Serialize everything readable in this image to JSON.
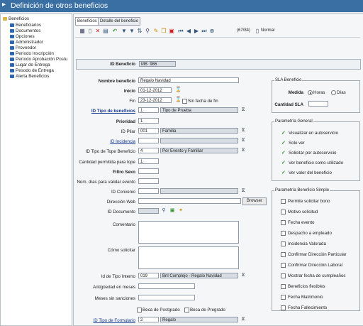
{
  "window": {
    "title": "Definición de otros beneficios"
  },
  "tree": {
    "root": "Beneficios",
    "items": [
      "Beneficiarios",
      "Documentos",
      "Opciones",
      "Administrador",
      "Proveedor",
      "Período Inscripción",
      "Período Aprobación Postu",
      "Lugar de Entrega",
      "Pesodo de Entrega",
      "Alerta Beneficios"
    ]
  },
  "tabs": [
    "Beneficios",
    "Detalle del beneficio"
  ],
  "toolbar": {
    "counter": "(67/84)",
    "mode": "Normal"
  },
  "form": {
    "id_beneficio_label": "ID Beneficio",
    "id_beneficio_value": "MB_986",
    "nombre_label": "Nombre beneficio",
    "nombre_value": "Regalo Navidad",
    "inicio_label": "Inicio",
    "inicio_value": "01-12-2012",
    "fin_label": "Fin",
    "fin_value": "23-12-2012",
    "sin_fecha_label": "Sin fecha de fin",
    "tipo_label": "ID Tipo de beneficios",
    "tipo_id": "1",
    "tipo_desc": "Tipo de Prueba",
    "prioridad_label": "Prioridad",
    "prioridad_value": "1",
    "pilar_label": "ID Pilar",
    "pilar_id": "001",
    "pilar_desc": "Familia",
    "incidencia_label": "ID Incidencia",
    "tope_label": "ID Tipo de Tope Beneficio",
    "tope_id": "4",
    "tope_desc": "Por Evento y Familiar",
    "cantidad_label": "Cantidad permitida para tope",
    "cantidad_value": "1",
    "sexo_label": "Filtro Sexo",
    "num_dias_label": "Núm. días para validar evento",
    "convenio_label": "ID Convenio",
    "web_label": "Dirección Web",
    "browser_label": "Browser",
    "documento_label": "ID Documento",
    "comentario_label": "Comentario",
    "como_label": "Cómo solicitar",
    "interno_label": "Id de Tipo Interno",
    "interno_id": "019",
    "interno_desc": "Bnl Complejo - Regalo Navidad",
    "antiguedad_label": "Antigüedad en meses",
    "meses_label": "Meses sin sanciones",
    "postgrado_label": "Beca de Postgrado",
    "pregrado_label": "Beca de Pregrado",
    "formulario_label": "ID Tipo de Formulario",
    "formulario_id": "2",
    "formulario_desc": "Regalo"
  },
  "sla": {
    "title": "SLA Beneficio",
    "medida_label": "Medida",
    "horas": "Horas",
    "dias": "Días",
    "cantidad_label": "Cantidad SLA"
  },
  "param_general": {
    "title": "Parametría General",
    "items": [
      {
        "label": "Visualizar en autoservicio",
        "checked": true
      },
      {
        "label": "Solo ver",
        "checked": true
      },
      {
        "label": "Solicitar por autoservicio",
        "checked": true
      },
      {
        "label": "Ver beneficio como utilizado",
        "checked": true
      },
      {
        "label": "Ver valor del beneficio",
        "checked": true
      }
    ]
  },
  "param_simple": {
    "title": "Parametría Beneficio Simple",
    "items": [
      {
        "label": "Permite solicitar bono"
      },
      {
        "label": "Motivo solicitud"
      },
      {
        "label": "Fecha evento"
      },
      {
        "label": "Despacho a empleado"
      },
      {
        "label": "Incidencia Valorada"
      },
      {
        "label": "Confirmar Dirección Particular"
      },
      {
        "label": "Confirmar Dirección Laboral"
      },
      {
        "label": "Mostrar fecha de cumpleaños"
      },
      {
        "label": "Beneficios flexibles"
      },
      {
        "label": "Fecha Matrimonio"
      },
      {
        "label": "Fecha Fallecimiento"
      }
    ]
  },
  "colors": {
    "titlebar": "#3a6fa3",
    "link": "#1a3d8f",
    "check": "#2a8a2a"
  }
}
